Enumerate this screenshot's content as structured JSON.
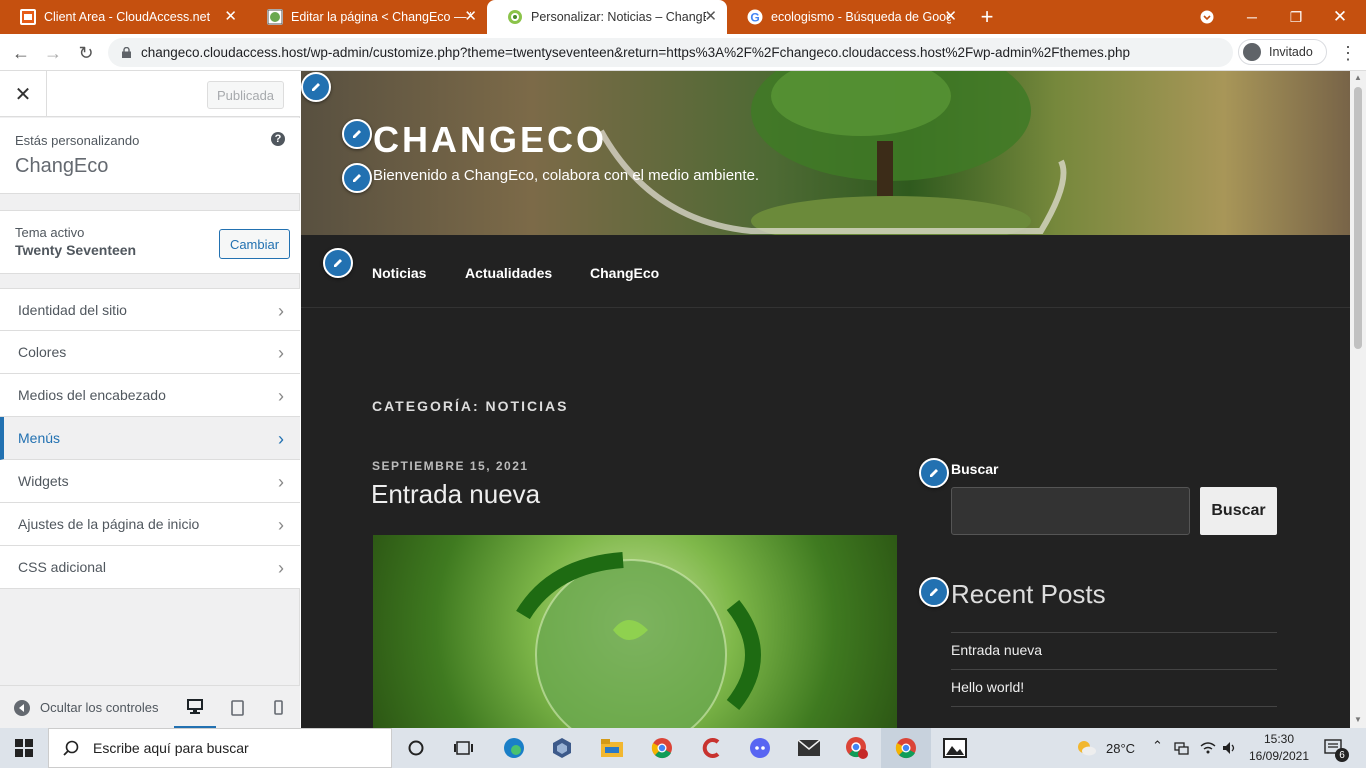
{
  "browser": {
    "tabs": [
      {
        "title": "Client Area - CloudAccess.net",
        "favicon": "cloudaccess-icon"
      },
      {
        "title": "Editar la página < ChangEco — W",
        "favicon": "changeco-icon"
      },
      {
        "title": "Personalizar: Noticias – ChangEco",
        "favicon": "changeco-icon"
      },
      {
        "title": "ecologismo - Búsqueda de Goog",
        "favicon": "google-icon"
      }
    ],
    "url": "changeco.cloudaccess.host/wp-admin/customize.php?theme=twentyseventeen&return=https%3A%2F%2Fchangeco.cloudaccess.host%2Fwp-admin%2Fthemes.php",
    "profile_label": "Invitado",
    "accent": "#c5500f"
  },
  "customizer": {
    "publish_label": "Publicada",
    "customizing_label": "Estás personalizando",
    "site_name": "ChangEco",
    "theme_label": "Tema activo",
    "theme_name": "Twenty Seventeen",
    "change_label": "Cambiar",
    "menu": [
      {
        "label": "Identidad del sitio"
      },
      {
        "label": "Colores"
      },
      {
        "label": "Medios del encabezado"
      },
      {
        "label": "Menús"
      },
      {
        "label": "Widgets"
      },
      {
        "label": "Ajustes de la página de inicio"
      },
      {
        "label": "CSS adicional"
      }
    ],
    "hide_controls_label": "Ocultar los controles",
    "accent": "#2271b1"
  },
  "preview": {
    "site_title": "CHANGECO",
    "tagline": "Bienvenido a ChangEco, colabora con el medio ambiente.",
    "nav": [
      "Noticias",
      "Actualidades",
      "ChangEco"
    ],
    "category_heading": "CATEGORÍA: NOTICIAS",
    "post_date": "SEPTIEMBRE 15, 2021",
    "post_title": "Entrada nueva",
    "search_widget_title": "Buscar",
    "search_button": "Buscar",
    "recent_posts_title": "Recent Posts",
    "recent_posts": [
      "Entrada nueva",
      "Hello world!"
    ]
  },
  "taskbar": {
    "search_placeholder": "Escribe aquí para buscar",
    "weather": "28°C",
    "time": "15:30",
    "date": "16/09/2021",
    "notifications": "6"
  }
}
